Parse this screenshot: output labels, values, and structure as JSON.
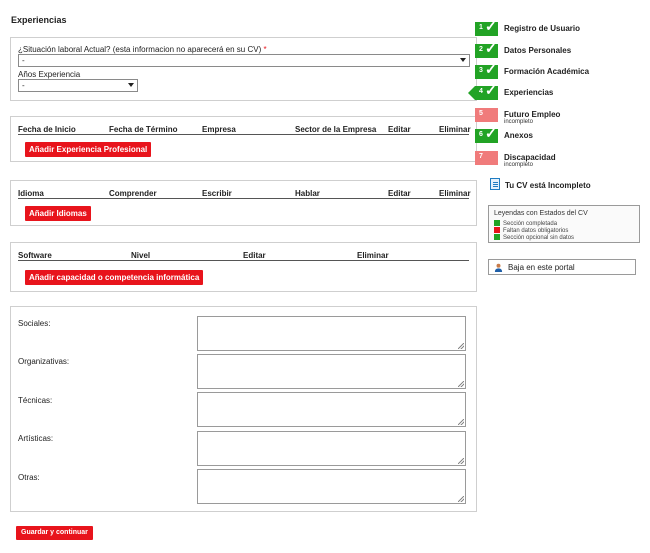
{
  "page": {
    "title": "Experiencias"
  },
  "situation": {
    "label": "¿Situación laboral Actual? (esta informacion no aparecerá en su CV)",
    "required_mark": "*",
    "value": "-"
  },
  "years": {
    "label": "Años Experiencia",
    "value": "-"
  },
  "experience": {
    "columns": [
      "Fecha de Inicio",
      "Fecha de Término",
      "Empresa",
      "Sector de la Empresa",
      "Editar",
      "Eliminar"
    ],
    "add_button": "Añadir Experiencia Profesional"
  },
  "languages": {
    "columns": [
      "Idioma",
      "Comprender",
      "Escribir",
      "Hablar",
      "Editar",
      "Eliminar"
    ],
    "add_button": "Añadir Idiomas"
  },
  "software": {
    "columns": [
      "Software",
      "Nivel",
      "Editar",
      "Eliminar"
    ],
    "add_button": "Añadir capacidad o competencia informática"
  },
  "skills": {
    "items": [
      {
        "label": "Sociales:"
      },
      {
        "label": "Organizativas:"
      },
      {
        "label": "Técnicas:"
      },
      {
        "label": "Artísticas:"
      },
      {
        "label": "Otras:"
      }
    ]
  },
  "save_button": "Guardar y continuar",
  "steps": [
    {
      "num": "1",
      "label": "Registro de Usuario",
      "status": "complete"
    },
    {
      "num": "2",
      "label": "Datos Personales",
      "status": "complete"
    },
    {
      "num": "3",
      "label": "Formación Académica",
      "status": "complete"
    },
    {
      "num": "4",
      "label": "Experiencias",
      "status": "active"
    },
    {
      "num": "5",
      "label": "Futuro Empleo",
      "sub": "incompleto",
      "status": "incomplete"
    },
    {
      "num": "6",
      "label": "Anexos",
      "status": "complete"
    },
    {
      "num": "7",
      "label": "Discapacidad",
      "sub": "incompleto",
      "status": "incomplete"
    }
  ],
  "cv_status": "Tu CV está Incompleto",
  "legend": {
    "title": "Leyendas con Estados del CV",
    "items": [
      {
        "label": "Sección completada",
        "color": "#22a325"
      },
      {
        "label": "Faltan datos obligatorios",
        "color": "#e8141c"
      },
      {
        "label": "Sección opcional sin datos",
        "color": "#22a325"
      }
    ]
  },
  "leave_portal": "Baja en este portal",
  "colors": {
    "accent_red": "#e8141c",
    "accent_green": "#22a325",
    "pending_red": "#f07b7b"
  }
}
